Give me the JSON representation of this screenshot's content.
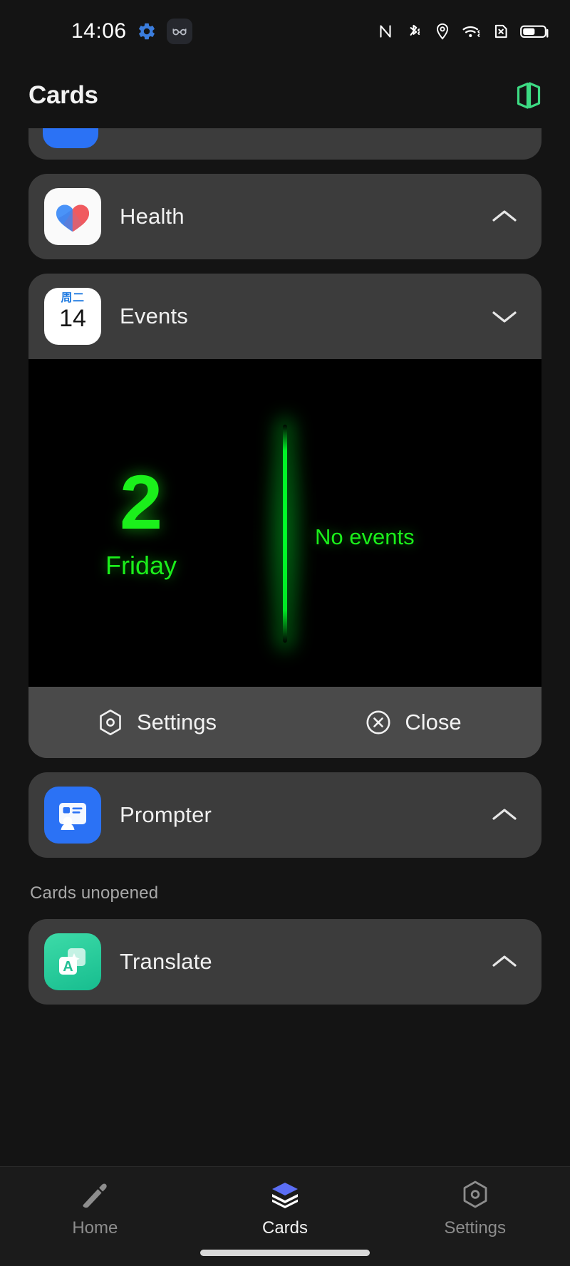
{
  "status_bar": {
    "time": "14:06",
    "left_icons": [
      {
        "name": "settings-gear-icon",
        "color": "#3b7ddd"
      },
      {
        "name": "glasses-icon",
        "color": "#9aa0aa"
      }
    ],
    "right_icons": [
      {
        "name": "nfc-icon"
      },
      {
        "name": "bluetooth-icon"
      },
      {
        "name": "location-icon"
      },
      {
        "name": "wifi-icon"
      },
      {
        "name": "no-sim-icon"
      },
      {
        "name": "battery-icon"
      }
    ]
  },
  "header": {
    "title": "Cards",
    "action_icon": "cards-stack-icon",
    "action_icon_color": "#3ddb83"
  },
  "cards": [
    {
      "id": "clipped",
      "name": "",
      "icon": "blue-app-icon",
      "icon_color": "#2b72f5",
      "expanded": false
    },
    {
      "id": "health",
      "name": "Health",
      "icon": "health-heart-icon",
      "icon_bg": "#fafafa",
      "chevron": "chevron-up-icon",
      "expanded": false
    },
    {
      "id": "events",
      "name": "Events",
      "icon": "calendar-icon",
      "icon_bg": "#ffffff",
      "calendar_weekday": "周二",
      "calendar_day": "14",
      "chevron": "chevron-down-icon",
      "expanded": true
    },
    {
      "id": "prompter",
      "name": "Prompter",
      "icon": "prompter-card-icon",
      "icon_bg": "#2b72f5",
      "chevron": "chevron-up-icon",
      "expanded": false
    }
  ],
  "events_widget": {
    "day_number": "2",
    "day_name": "Friday",
    "message": "No events",
    "text_color": "#1bf01b",
    "background": "#000000",
    "actions": [
      {
        "label": "Settings",
        "icon": "hexagon-settings-icon"
      },
      {
        "label": "Close",
        "icon": "close-circle-icon"
      }
    ]
  },
  "unopened_section": {
    "label": "Cards unopened",
    "cards": [
      {
        "id": "translate",
        "name": "Translate",
        "icon": "translate-icon",
        "icon_bg": "#2ec7a0",
        "icon_letter": "A",
        "chevron": "chevron-up-icon"
      }
    ]
  },
  "bottom_nav": {
    "items": [
      {
        "label": "Home",
        "icon": "home-pointer-icon",
        "active": false
      },
      {
        "label": "Cards",
        "icon": "cards-stack-filled-icon",
        "active": true
      },
      {
        "label": "Settings",
        "icon": "hexagon-settings-icon",
        "active": false
      }
    ],
    "active_color": "#f2f2f2",
    "inactive_color": "#8d8d8d"
  }
}
